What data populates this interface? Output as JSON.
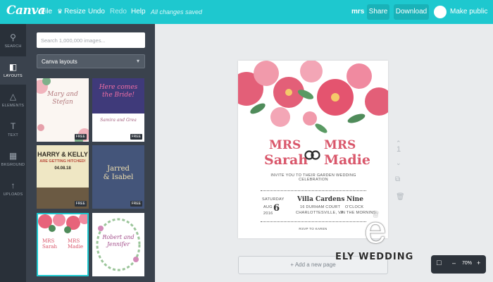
{
  "topbar": {
    "logo": "Canva",
    "menu": [
      "File",
      "Resize",
      "Undo",
      "Redo",
      "Help"
    ],
    "status": "All changes saved",
    "user": "mrs",
    "share_label": "Share",
    "download_label": "Download",
    "make_public_label": "Make public"
  },
  "leftnav": {
    "items": [
      {
        "label": "SEARCH",
        "icon": "search-icon"
      },
      {
        "label": "LAYOUTS",
        "icon": "layouts-icon"
      },
      {
        "label": "ELEMENTS",
        "icon": "elements-icon"
      },
      {
        "label": "TEXT",
        "icon": "text-icon"
      },
      {
        "label": "BKGROUND",
        "icon": "background-icon"
      },
      {
        "label": "UPLOADS",
        "icon": "uploads-icon"
      }
    ]
  },
  "panel": {
    "search_placeholder": "Search 1,000,000 images...",
    "dropdown_value": "Canva layouts",
    "thumbs": [
      {
        "line1": "Mary and",
        "line2": "Stefan",
        "free": "FREE"
      },
      {
        "line1": "Here comes",
        "line2": "the Bride!",
        "line3": "Samira and Grea",
        "free": "FREE"
      },
      {
        "line1": "HARRY & KELLY",
        "line2": "ARE GETTING HITCHED!",
        "line3": "04.08.18",
        "free": "FREE"
      },
      {
        "line1": "Jarred",
        "line2": "& Isabel",
        "free": "FREE"
      },
      {
        "line1": "MRS",
        "line2": "Sarah",
        "line3": "MRS",
        "line4": "Madie"
      },
      {
        "line1": "Robert and",
        "line2": "Jennifer"
      }
    ]
  },
  "card": {
    "left_title": "MRS",
    "left_name": "Sarah",
    "right_title": "MRS",
    "right_name": "Madie",
    "invite": "INVITE YOU TO THEIR GARDEN WEDDING CELEBRATION",
    "day": "SATURDAY",
    "month": "AUG",
    "date": "6",
    "year": "2016",
    "venue": "Villa Cardens",
    "address1": "16 DURHAM COURT",
    "address2": "CHARLOTTESVILLE, VA",
    "time": "Nine",
    "time2": "O'CLOCK",
    "time3": "IN THE MORNING",
    "rsvp": "RSVP TO KAREN"
  },
  "side_tools": {
    "page_number": "1"
  },
  "add_page_label": "+ Add a new page",
  "zoom": {
    "minus": "–",
    "value": "70%",
    "plus": "+"
  },
  "watermark": {
    "text": "ELY WEDDING"
  },
  "colors": {
    "topbar": "#1ec8cf",
    "nav": "#293039",
    "panel": "#3a424d",
    "accent_pink": "#d9576b"
  }
}
